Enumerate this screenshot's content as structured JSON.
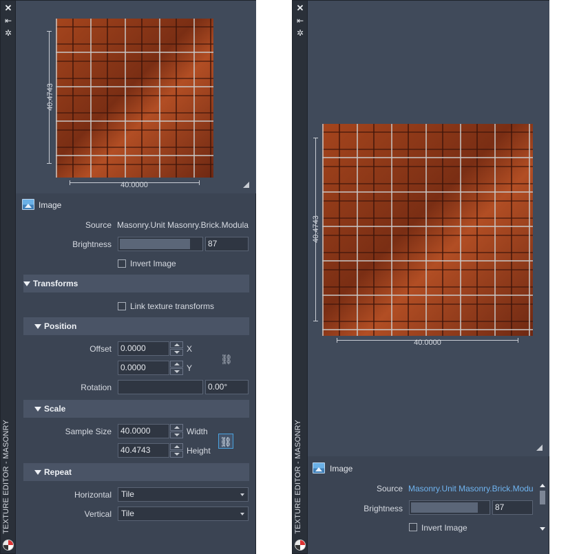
{
  "palette_title": "TEXTURE EDITOR - MASONRY",
  "left": {
    "preview": {
      "height_label": "40.4743",
      "width_label": "40.0000"
    },
    "image_header": "Image",
    "source_label": "Source",
    "source_value": "Masonry.Unit Masonry.Brick.Modula",
    "brightness_label": "Brightness",
    "brightness_value": "87",
    "brightness_level": 0.87,
    "invert_label": "Invert Image",
    "transforms_header": "Transforms",
    "link_transforms_label": "Link texture transforms",
    "position_header": "Position",
    "offset_label": "Offset",
    "offset_x": "0.0000",
    "offset_y": "0.0000",
    "x_axis": "X",
    "y_axis": "Y",
    "rotation_label": "Rotation",
    "rotation_value": "0.00°",
    "scale_header": "Scale",
    "sample_size_label": "Sample Size",
    "width_value": "40.0000",
    "width_label": "Width",
    "height_value": "40.4743",
    "height_label": "Height",
    "repeat_header": "Repeat",
    "horizontal_label": "Horizontal",
    "horizontal_value": "Tile",
    "vertical_label": "Vertical",
    "vertical_value": "Tile"
  },
  "right": {
    "preview": {
      "height_label": "40.4743",
      "width_label": "40.0000"
    },
    "image_header": "Image",
    "source_label": "Source",
    "source_value": "Masonry.Unit Masonry.Brick.Modu",
    "brightness_label": "Brightness",
    "brightness_value": "87",
    "brightness_level": 0.87,
    "invert_label": "Invert Image"
  },
  "colors": {
    "panel_bg": "#3b4453",
    "titlebar_bg": "#2a3039",
    "section_bg": "#4a5466",
    "link_active": "#4aa3df",
    "source_link": "#6fb4f0"
  },
  "icons": [
    "close-icon",
    "pin-icon",
    "gear-icon",
    "image-icon",
    "link-icon",
    "app-icon"
  ]
}
